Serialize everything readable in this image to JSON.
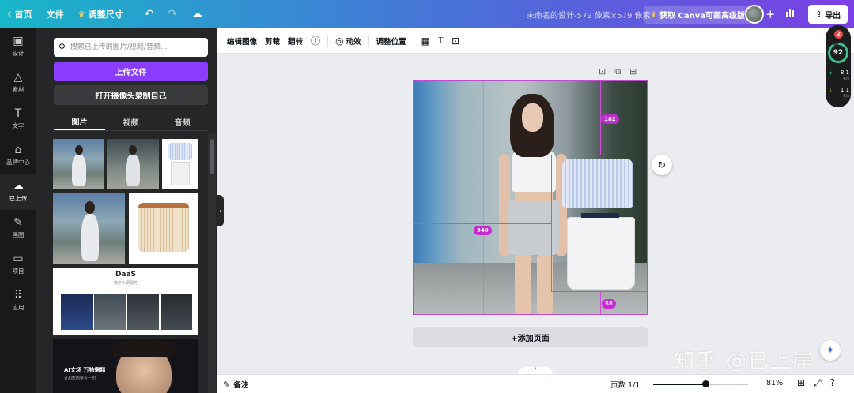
{
  "topbar": {
    "home": "首页",
    "file": "文件",
    "resize": "调整尺寸",
    "design_title": "未命名的设计-579 像素×579 像素",
    "upgrade": "获取 Canva可画高级版",
    "export": "导出"
  },
  "rail": {
    "items": [
      {
        "label": "设计",
        "icon": "layout-icon"
      },
      {
        "label": "素材",
        "icon": "shapes-icon"
      },
      {
        "label": "文字",
        "icon": "text-icon"
      },
      {
        "label": "品牌中心",
        "icon": "brand-icon"
      },
      {
        "label": "已上传",
        "icon": "upload-cloud-icon"
      },
      {
        "label": "画图",
        "icon": "draw-icon"
      },
      {
        "label": "项目",
        "icon": "folder-icon"
      },
      {
        "label": "应用",
        "icon": "apps-icon"
      }
    ],
    "active_index": 4
  },
  "panel": {
    "search_placeholder": "搜索已上传的图片/视频/音频...",
    "upload_button": "上传文件",
    "record_button": "打开摄像头录制自己",
    "tabs": [
      "图片",
      "视频",
      "音频"
    ],
    "active_tab": 0,
    "daas": {
      "title": "DaaS",
      "subtitle": "数字人即服务"
    },
    "ai_card": {
      "headline": "AI文场 万物需精",
      "sub": "让AI帮你整合一切"
    }
  },
  "subbar": {
    "edit_image": "编辑图像",
    "crop": "剪裁",
    "flip": "翻转",
    "animate": "动效",
    "position": "调整位置"
  },
  "canvas": {
    "measure_top": "182",
    "measure_left": "340",
    "measure_bottom": "58",
    "add_page": "+添加页面"
  },
  "bottombar": {
    "notes": "备注",
    "pages": "页数 1/1",
    "zoom": "81%",
    "zoom_level": 0.55
  },
  "widget": {
    "badge": "2",
    "score": "92",
    "score_fraction": 0.92,
    "up_rate": "8.1",
    "up_unit": "K/s",
    "down_rate": "1.1",
    "down_unit": "K/s"
  },
  "watermark": "知乎 @已上岸",
  "colors": {
    "accent": "#8b3dff",
    "guide": "#d04ad8",
    "rail_bg": "#18191b",
    "panel_bg": "#252627"
  }
}
